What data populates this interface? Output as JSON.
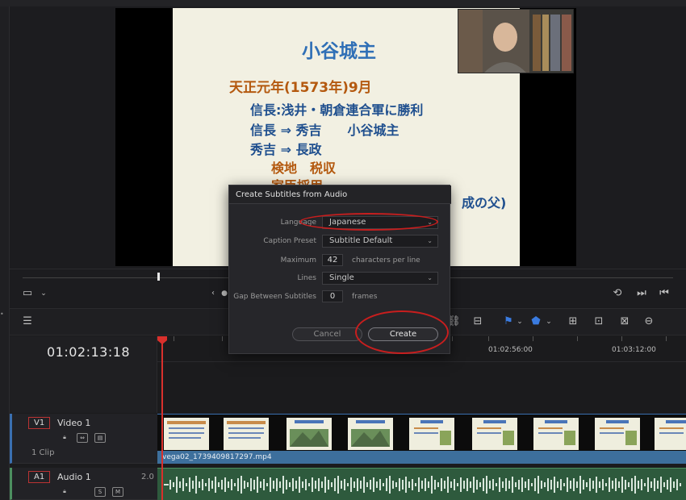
{
  "timeline": {
    "timecode": "01:02:13:18",
    "ruler_labels": [
      "01:02:56:00",
      "01:03:12:00"
    ]
  },
  "viewer": {
    "slide_lines": [
      "小谷城主",
      "天正元年(1573年)9月",
      "信長:浅井・朝倉連合軍に勝利",
      "信長 ⇒ 秀吉　　小谷城主",
      "秀吉 ⇒ 長政",
      "検地　税収",
      "家臣採用",
      "成の父)"
    ]
  },
  "dialog": {
    "title": "Create Subtitles from Audio",
    "language_label": "Language",
    "language_value": "Japanese",
    "caption_preset_label": "Caption Preset",
    "caption_preset_value": "Subtitle Default",
    "maximum_label": "Maximum",
    "maximum_value": "42",
    "maximum_unit": "characters per line",
    "lines_label": "Lines",
    "lines_value": "Single",
    "gap_label": "Gap Between Subtitles",
    "gap_value": "0",
    "gap_unit": "frames",
    "cancel_label": "Cancel",
    "create_label": "Create"
  },
  "tracks": {
    "video": {
      "id": "V1",
      "name": "Video 1",
      "clip_count": "1 Clip",
      "clip_name": "vega02_1739409817297.mp4"
    },
    "audio": {
      "id": "A1",
      "name": "Audio 1",
      "level": "2.0",
      "solo": "S",
      "mute": "M"
    }
  },
  "colors": {
    "accent_blue": "#3a6fb0",
    "playhead_red": "#d9302c",
    "annotation_red": "#c81e1e",
    "clip_blue": "#3d6f9c",
    "audio_green": "#2e5a3d",
    "slide_title_blue": "#2f6fb6",
    "slide_orange": "#b4590f",
    "slide_text_blue": "#1f4f8e"
  }
}
